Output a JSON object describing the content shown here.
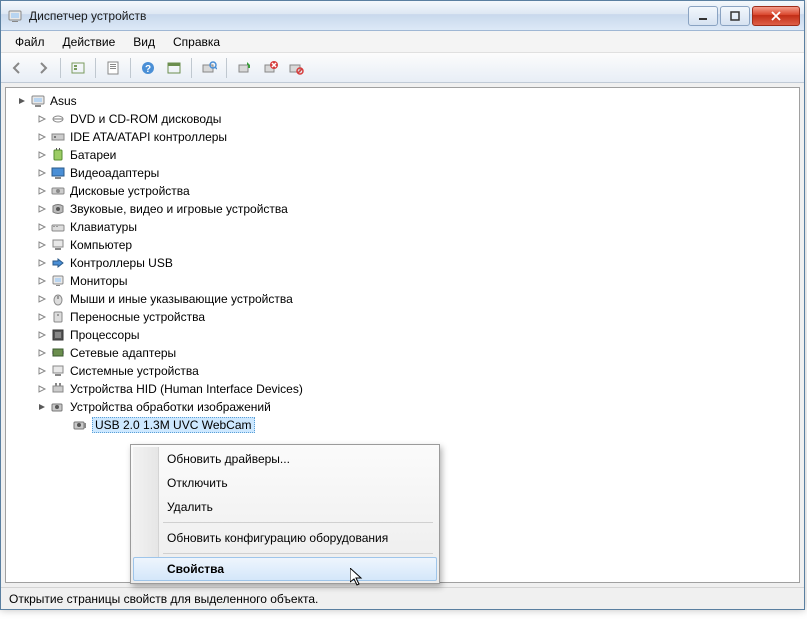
{
  "window": {
    "title": "Диспетчер устройств"
  },
  "menubar": {
    "file": "Файл",
    "action": "Действие",
    "view": "Вид",
    "help": "Справка"
  },
  "tree": {
    "root": "Asus",
    "categories": [
      "DVD и CD-ROM дисководы",
      "IDE ATA/ATAPI контроллеры",
      "Батареи",
      "Видеоадаптеры",
      "Дисковые устройства",
      "Звуковые, видео и игровые устройства",
      "Клавиатуры",
      "Компьютер",
      "Контроллеры USB",
      "Мониторы",
      "Мыши и иные указывающие устройства",
      "Переносные устройства",
      "Процессоры",
      "Сетевые адаптеры",
      "Системные устройства",
      "Устройства HID (Human Interface Devices)",
      "Устройства обработки изображений"
    ],
    "selected_device": "USB 2.0 1.3M UVC WebCam"
  },
  "context_menu": {
    "update_drivers": "Обновить драйверы...",
    "disable": "Отключить",
    "delete": "Удалить",
    "scan_hardware": "Обновить конфигурацию оборудования",
    "properties": "Свойства"
  },
  "statusbar": {
    "text": "Открытие страницы свойств для выделенного объекта."
  }
}
